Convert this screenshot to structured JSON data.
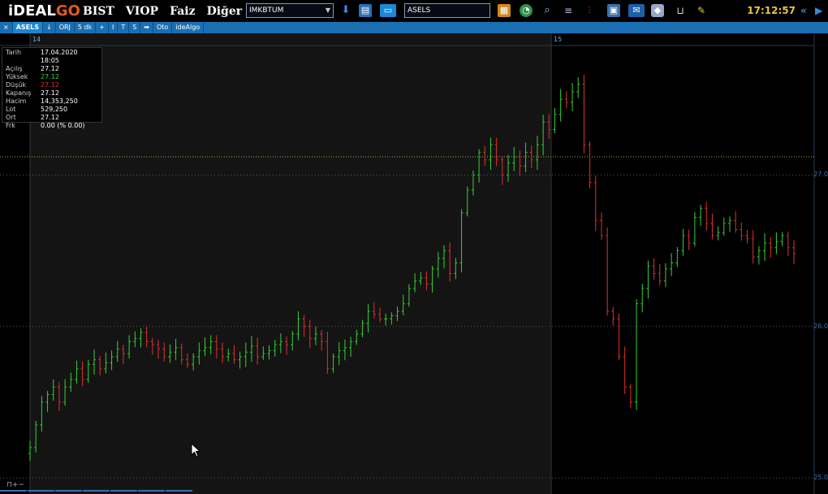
{
  "app": {
    "logo_main": "iDEAL",
    "logo_accent": "GO",
    "menus": [
      "BIST",
      "VIOP",
      "Faiz",
      "Diğer"
    ],
    "market_combo": "IMKBTUM",
    "symbol_input": "ASELS",
    "clock": "17:12:57"
  },
  "chart_toolbar": {
    "items": [
      "×",
      "ASELS",
      "↓",
      "ORJ",
      "5 dk",
      "+",
      "I",
      "T",
      "S",
      "➡",
      "Oto",
      "ideAlgo"
    ]
  },
  "info_panel": {
    "rows": [
      {
        "k": "Tarih",
        "v": "17.04.2020 18:05",
        "c": ""
      },
      {
        "k": "Açılış",
        "v": "27.12",
        "c": ""
      },
      {
        "k": "Yüksek",
        "v": "27.12",
        "c": "up"
      },
      {
        "k": "Düşük",
        "v": "27.12",
        "c": "down"
      },
      {
        "k": "Kapanış",
        "v": "27.12",
        "c": ""
      },
      {
        "k": "Hacim",
        "v": "14,353,250",
        "c": ""
      },
      {
        "k": "Lot",
        "v": "529,250",
        "c": ""
      },
      {
        "k": "Ort",
        "v": "27.12",
        "c": ""
      },
      {
        "k": "Frk",
        "v": "0.00 (% 0.00)",
        "c": ""
      }
    ]
  },
  "chart_data": {
    "type": "ohlc",
    "x_labels": [
      "14",
      "15"
    ],
    "y_ticks": [
      25.0,
      26.0,
      27.0
    ],
    "y_tick_labels": [
      "25.0",
      "26.0",
      "27.0"
    ],
    "ylim": [
      24.92,
      27.85
    ],
    "up_color": "#34d134",
    "down_color": "#e03131",
    "ref_line": 27.12,
    "closes": [
      25.2,
      25.35,
      25.5,
      25.55,
      25.6,
      25.5,
      25.6,
      25.65,
      25.72,
      25.65,
      25.75,
      25.78,
      25.72,
      25.76,
      25.8,
      25.85,
      25.82,
      25.9,
      25.92,
      25.96,
      25.9,
      25.88,
      25.85,
      25.8,
      25.83,
      25.86,
      25.78,
      25.75,
      25.8,
      25.84,
      25.86,
      25.9,
      25.85,
      25.8,
      25.82,
      25.78,
      25.8,
      25.83,
      25.87,
      25.8,
      25.82,
      25.84,
      25.88,
      25.9,
      25.88,
      25.95,
      26.05,
      26.0,
      25.92,
      25.95,
      25.9,
      25.72,
      25.8,
      25.84,
      25.86,
      25.9,
      25.95,
      26.02,
      26.1,
      26.08,
      26.05,
      26.05,
      26.07,
      26.1,
      26.15,
      26.25,
      26.3,
      26.32,
      26.28,
      26.38,
      26.45,
      26.5,
      26.35,
      26.42,
      26.75,
      26.9,
      27.0,
      27.15,
      27.1,
      27.2,
      27.1,
      27.0,
      27.08,
      27.12,
      27.06,
      27.15,
      27.1,
      27.2,
      27.35,
      27.3,
      27.4,
      27.5,
      27.48,
      27.55,
      27.6,
      27.2,
      26.95,
      26.7,
      26.6,
      26.1,
      26.05,
      25.8,
      25.6,
      25.5,
      26.15,
      26.25,
      26.4,
      26.35,
      26.3,
      26.38,
      26.42,
      26.5,
      26.6,
      26.55,
      26.72,
      26.78,
      26.68,
      26.6,
      26.62,
      26.68,
      26.7,
      26.64,
      26.6,
      26.58,
      26.46,
      26.5,
      26.55,
      26.52,
      26.56,
      26.6,
      26.52,
      26.48
    ]
  }
}
